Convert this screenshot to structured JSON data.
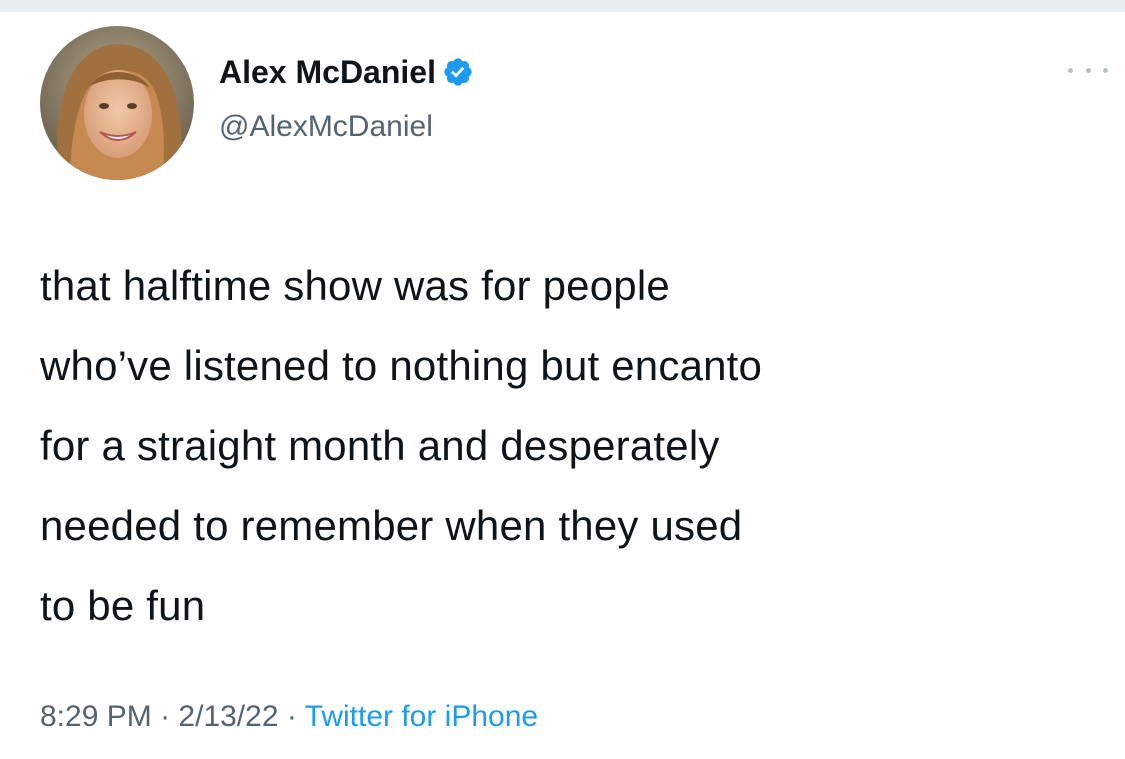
{
  "tweet": {
    "display_name": "Alex McDaniel",
    "handle": "@AlexMcDaniel",
    "verified": true,
    "text_lines": [
      "that halftime show was for people",
      "who’ve listened to nothing but encanto",
      "for a straight month and desperately",
      "needed to remember when they used",
      "to be fun"
    ],
    "time": "8:29 PM",
    "separator": "·",
    "date": "2/13/22",
    "source": "Twitter for iPhone"
  },
  "icons": {
    "verified": "verified-badge-icon",
    "more": "more-options-icon"
  },
  "colors": {
    "text": "#0f1419",
    "secondary": "#536471",
    "accent": "#1d9bf0"
  }
}
